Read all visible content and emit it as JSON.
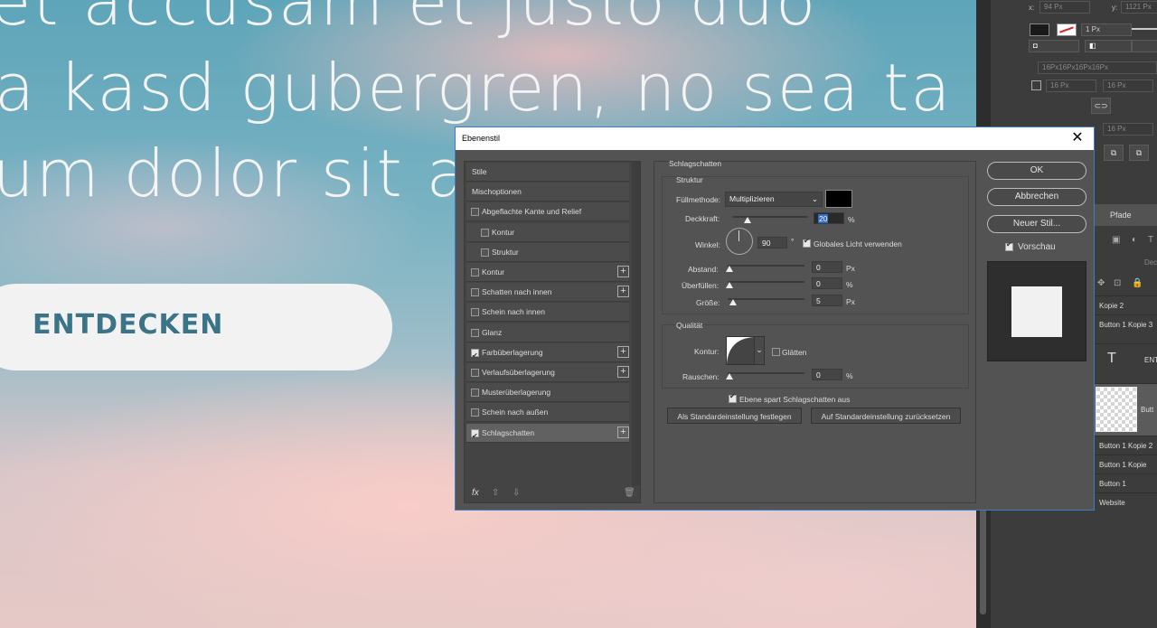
{
  "canvas": {
    "line1": "et accusam et justo duo",
    "line2": "a kasd gubergren, no sea ta",
    "line3": "um dolor sit a",
    "button_label": "ENTDECKEN"
  },
  "right_panel": {
    "x_field": "94 Px",
    "y_label": "y:",
    "y_field": "1121 Px",
    "stroke_width": "1 Px",
    "radius_field": "16Px16Px16Px16Px",
    "corner1": "16 Px",
    "corner2": "16 Px",
    "corner3": "16 Px",
    "tab_paths": "Pfade",
    "dec_label": "Dec",
    "layers": [
      "Kopie 2",
      "Button 1 Kopie 3",
      "ENT",
      "Butt",
      "Button 1 Kopie 2",
      "Button 1 Kopie",
      "Button 1",
      "Website"
    ],
    "text_layer_icon": "T"
  },
  "dialog": {
    "title": "Ebenenstil",
    "close_glyph": "✕",
    "sidebar": [
      {
        "label": "Stile",
        "checkbox": null,
        "plus": false
      },
      {
        "label": "Mischoptionen",
        "checkbox": null,
        "plus": false
      },
      {
        "label": "Abgeflachte Kante und Relief",
        "checkbox": false,
        "plus": false
      },
      {
        "label": "Kontur",
        "checkbox": false,
        "plus": false,
        "indent": true
      },
      {
        "label": "Struktur",
        "checkbox": false,
        "plus": false,
        "indent": true
      },
      {
        "label": "Kontur",
        "checkbox": false,
        "plus": true
      },
      {
        "label": "Schatten nach innen",
        "checkbox": false,
        "plus": true
      },
      {
        "label": "Schein nach innen",
        "checkbox": false,
        "plus": false
      },
      {
        "label": "Glanz",
        "checkbox": false,
        "plus": false
      },
      {
        "label": "Farbüberlagerung",
        "checkbox": true,
        "plus": true
      },
      {
        "label": "Verlaufsüberlagerung",
        "checkbox": false,
        "plus": true
      },
      {
        "label": "Musterüberlagerung",
        "checkbox": false,
        "plus": false
      },
      {
        "label": "Schein nach außen",
        "checkbox": false,
        "plus": false
      },
      {
        "label": "Schlagschatten",
        "checkbox": true,
        "plus": true,
        "selected": true
      }
    ],
    "sidebar_footer": {
      "fx": "fx",
      "up": "⇧",
      "down": "⇩",
      "trash": "🗑"
    },
    "section_title": "Schlagschatten",
    "struktur_title": "Struktur",
    "fuellmethode_label": "Füllmethode:",
    "fuellmethode_value": "Multiplizieren",
    "shadow_color": "#000000",
    "deckkraft_label": "Deckkraft:",
    "deckkraft_value": "20",
    "deckkraft_pct": 20,
    "percent": "%",
    "winkel_label": "Winkel:",
    "winkel_value": "90",
    "degree": "°",
    "global_light_label": "Globales Licht verwenden",
    "abstand_label": "Abstand:",
    "abstand_value": "0",
    "ueberfuellen_label": "Überfüllen:",
    "ueberfuellen_value": "0",
    "groesse_label": "Größe:",
    "groesse_value": "5",
    "px": "Px",
    "qualitaet_title": "Qualität",
    "kontur_label": "Kontur:",
    "glaetten_label": "Glätten",
    "rauschen_label": "Rauschen:",
    "rauschen_value": "0",
    "knockout_label": "Ebene spart Schlagschatten aus",
    "btn_default_set": "Als Standardeinstellung festlegen",
    "btn_default_reset": "Auf Standardeinstellung zurücksetzen",
    "ok": "OK",
    "cancel": "Abbrechen",
    "new_style": "Neuer Stil...",
    "preview_label": "Vorschau"
  }
}
